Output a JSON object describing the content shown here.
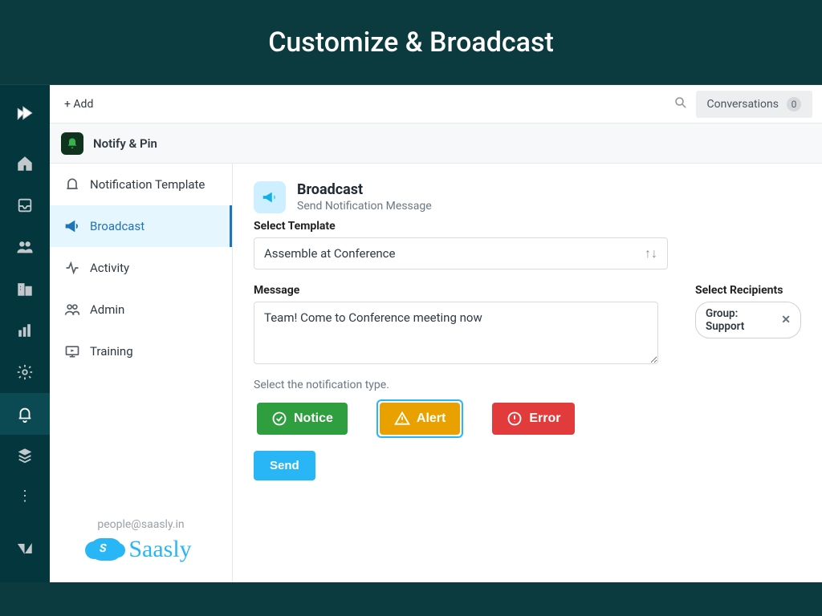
{
  "hero": {
    "title": "Customize & Broadcast"
  },
  "topbar": {
    "add_label": "+  Add",
    "conversations_label": "Conversations",
    "conversations_count": "0"
  },
  "app": {
    "title": "Notify & Pin"
  },
  "sidenav": {
    "items": [
      {
        "label": "Notification Template"
      },
      {
        "label": "Broadcast"
      },
      {
        "label": "Activity"
      },
      {
        "label": "Admin"
      },
      {
        "label": "Training"
      }
    ]
  },
  "brand": {
    "email": "people@saasly.in",
    "name": "Saasly"
  },
  "page": {
    "title": "Broadcast",
    "subtitle": "Send Notification Message",
    "template_label": "Select Template",
    "template_value": "Assemble at Conference",
    "message_label": "Message",
    "message_value": "Team! Come to Conference meeting now",
    "recipients_label": "Select Recipients",
    "recipient_chip": "Group: Support",
    "helper": "Select the notification type.",
    "types": {
      "notice": "Notice",
      "alert": "Alert",
      "error": "Error"
    },
    "send_label": "Send"
  }
}
